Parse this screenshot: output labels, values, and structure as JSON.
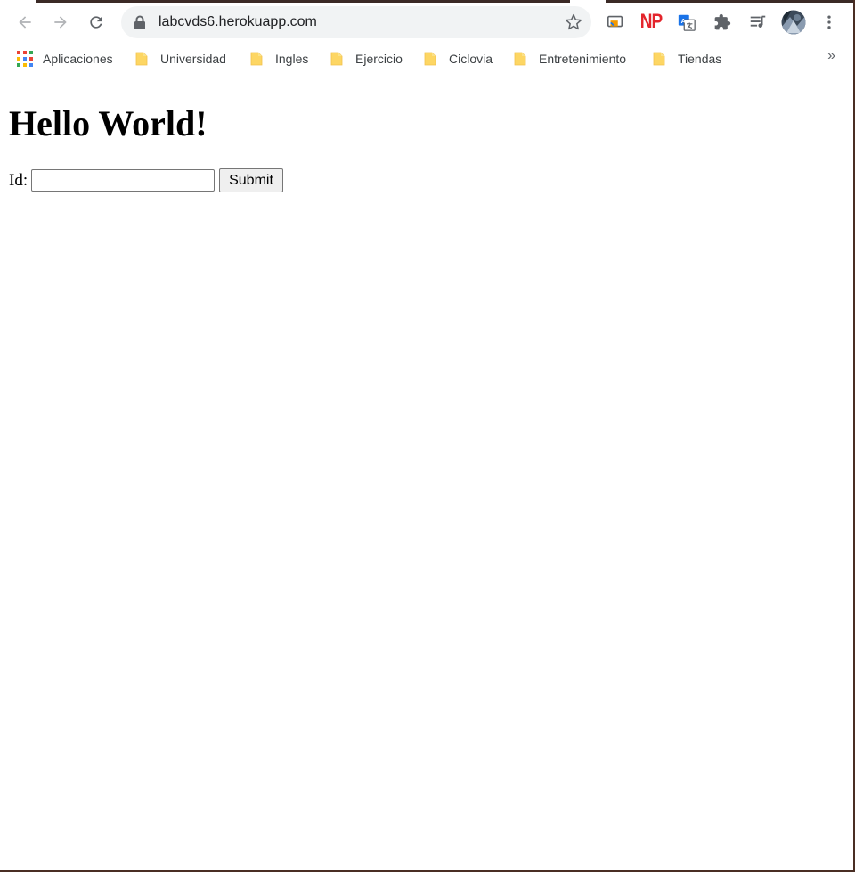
{
  "browser": {
    "url": "labcvds6.herokuapp.com",
    "extensions": [
      "cast-icon",
      "np-extension-icon",
      "translate-icon",
      "extensions-puzzle-icon",
      "reading-list-icon",
      "profile-avatar",
      "menu-kebab-icon"
    ],
    "np_label": "NP"
  },
  "bookmarks": {
    "apps_label": "Aplicaciones",
    "items": [
      {
        "label": "Universidad"
      },
      {
        "label": "Ingles"
      },
      {
        "label": "Ejercicio"
      },
      {
        "label": "Ciclovia"
      },
      {
        "label": "Entretenimiento"
      },
      {
        "label": "Tiendas"
      }
    ],
    "more_label": "»"
  },
  "page": {
    "heading": "Hello World!",
    "form": {
      "id_label": "Id:",
      "id_value": "",
      "submit_label": "Submit"
    }
  },
  "colors": {
    "omnibox_bg": "#f1f3f4",
    "folder_yellow": "#fdd663",
    "np_red": "#e3242b",
    "icon_gray": "#5f6368"
  }
}
